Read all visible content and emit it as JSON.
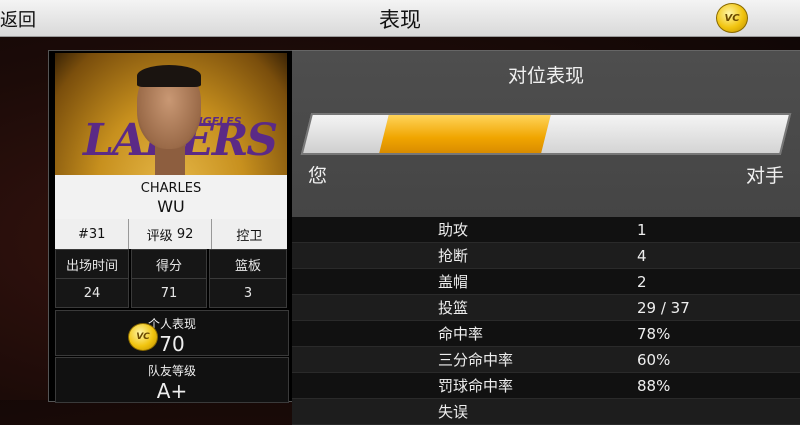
{
  "header": {
    "back_label": "返回",
    "title": "表现",
    "vc_badge": "VC"
  },
  "player": {
    "first_name": "CHARLES",
    "last_name": "WU",
    "number": "#31",
    "rating_label": "评级",
    "rating": "92",
    "position": "控卫",
    "team_logo": {
      "main": "LAKERS",
      "sub": "ANGELES"
    },
    "stats": [
      {
        "label": "出场时间",
        "value": "24"
      },
      {
        "label": "得分",
        "value": "71"
      },
      {
        "label": "篮板",
        "value": "3"
      }
    ],
    "performance": {
      "label": "个人表现",
      "value": "70",
      "icon_text": "VC"
    },
    "teammate": {
      "label": "队友等级",
      "value": "A+"
    }
  },
  "matchup": {
    "title": "对位表现",
    "you_label": "您",
    "opponent_label": "对手",
    "bar_you_fraction": 0.16,
    "bar_mid_fraction": 0.34,
    "accent_color": "#f0a500",
    "rows": [
      {
        "name": "助攻",
        "value": "1"
      },
      {
        "name": "抢断",
        "value": "4"
      },
      {
        "name": "盖帽",
        "value": "2"
      },
      {
        "name": "投篮",
        "value": "29 / 37"
      },
      {
        "name": "命中率",
        "value": "78%"
      },
      {
        "name": "三分命中率",
        "value": "60%"
      },
      {
        "name": "罚球命中率",
        "value": "88%"
      },
      {
        "name": "失误",
        "value": ""
      }
    ]
  }
}
